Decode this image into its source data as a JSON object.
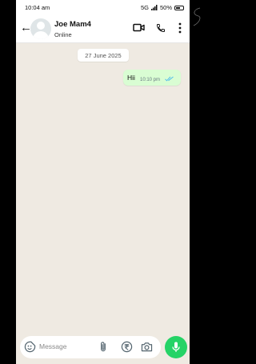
{
  "status_bar": {
    "time": "10:04 am",
    "network": "5G",
    "battery": "50%"
  },
  "header": {
    "name": "Joe Mam4",
    "status": "Online"
  },
  "conversation": {
    "date_label": "27 June 2025",
    "messages": [
      {
        "text": "Hii",
        "time": "10:10 pm",
        "read": true
      }
    ]
  },
  "composer": {
    "placeholder": "Message"
  },
  "icons": {
    "back": "back-arrow-icon",
    "avatar": "default-avatar-icon",
    "video": "video-call-icon",
    "call": "voice-call-icon",
    "menu": "more-options-icon",
    "emoji": "sticker-icon",
    "attach": "attach-icon",
    "payment": "rupee-payment-icon",
    "camera": "camera-icon",
    "mic": "mic-icon"
  },
  "colors": {
    "chat_bg": "#efeae2",
    "outgoing_bubble": "#d9fdd3",
    "accent": "#25d366",
    "read_ticks": "#53bdeb"
  }
}
